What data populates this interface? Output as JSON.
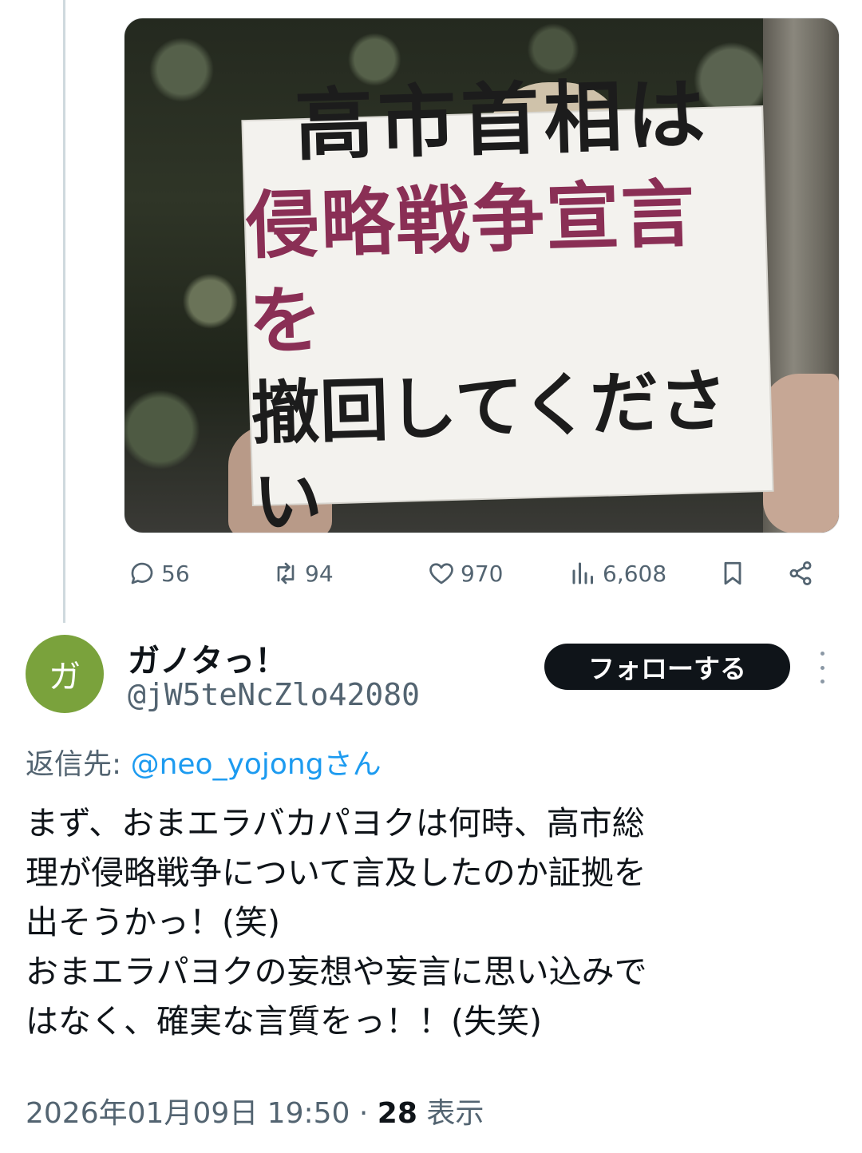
{
  "media": {
    "sign_line1": "高市首相は",
    "sign_line2": "侵略戦争宣言を",
    "sign_line3": "撤回してください"
  },
  "actions": {
    "replies": "56",
    "reposts": "94",
    "likes": "970",
    "views": "6,608",
    "icons": [
      "reply-icon",
      "repost-icon",
      "like-icon",
      "views-icon",
      "bookmark-icon",
      "share-icon"
    ]
  },
  "reply_post": {
    "avatar_letter": "ガ",
    "avatar_color": "#7aa23c",
    "display_name": "ガノタっ！",
    "handle": "@jW5teNcZlo42080",
    "follow_label": "フォローする",
    "reply_to_prefix": "返信先: ",
    "reply_to_mention": "@neo_yojongさん",
    "text": "まず、おまエラバカパヨクは何時、高市総\n理が侵略戦争について言及したのか証拠を\n出そうかっ！(笑)\nおまエラパヨクの妄想や妄言に思い込みで\nはなく、確実な言質をっ！！(失笑)",
    "timestamp": "2026年01月09日 19:50 · ",
    "views_count": "28",
    "views_label": " 表示"
  }
}
